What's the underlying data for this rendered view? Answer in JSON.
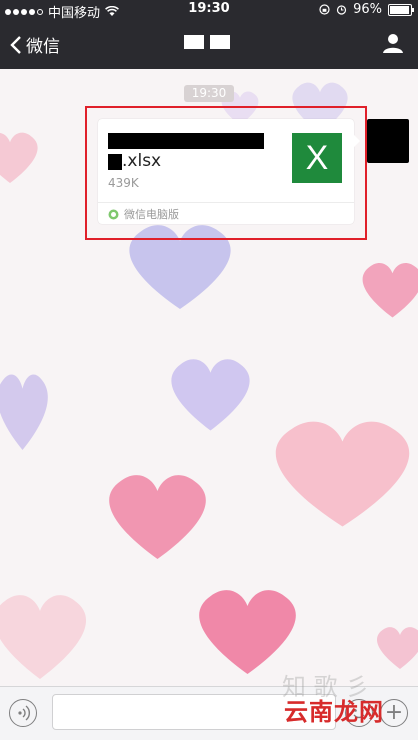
{
  "status_bar": {
    "carrier": "中国移动",
    "time": "19:30",
    "battery": "96%",
    "battery_level": 0.96,
    "icons": [
      "signal-dots",
      "wifi-icon",
      "rotation-lock-icon",
      "alarm-icon",
      "battery-icon"
    ]
  },
  "nav": {
    "back_label": "微信",
    "back_icon": "chevron-left-icon",
    "profile_icon": "person-icon"
  },
  "chat": {
    "timestamp": "19:30",
    "message": {
      "type": "file",
      "file_name": ".xlsx",
      "file_size": "439K",
      "file_icon_letter": "X",
      "source": "微信电脑版"
    }
  },
  "input_bar": {
    "voice_icon": "voice-icon",
    "emoji_icon": "emoji-icon",
    "plus_icon": "plus-icon",
    "plus_label": "+"
  },
  "watermark": {
    "text": "云南龙网",
    "faint_text": "知 歌 彡"
  },
  "colors": {
    "navbar": "#2a2a2f",
    "excel_green": "#1f8a3c",
    "highlight_red": "#e0202a"
  }
}
